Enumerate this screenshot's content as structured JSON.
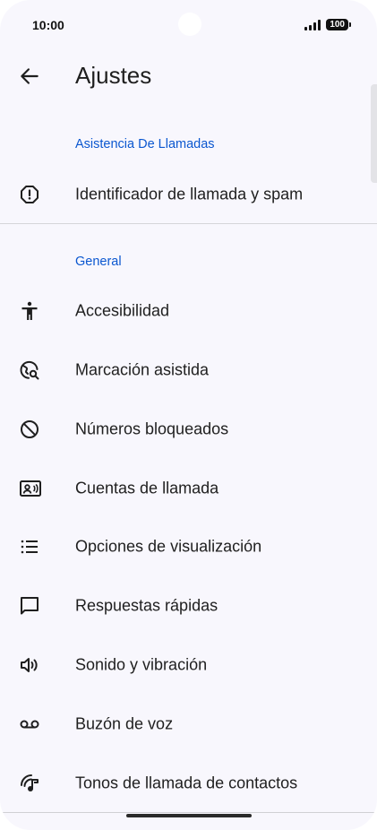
{
  "status": {
    "time": "10:00",
    "battery": "100"
  },
  "app_bar": {
    "title": "Ajustes"
  },
  "sections": {
    "call_assist": {
      "header": "Asistencia De Llamadas",
      "items": [
        {
          "label": "Identificador de llamada y spam",
          "icon": "alert-octagon-icon"
        }
      ]
    },
    "general": {
      "header": "General",
      "items": [
        {
          "label": "Accesibilidad",
          "icon": "accessibility-icon"
        },
        {
          "label": "Marcación asistida",
          "icon": "globe-search-icon"
        },
        {
          "label": "Números bloqueados",
          "icon": "block-icon"
        },
        {
          "label": "Cuentas de llamada",
          "icon": "contact-card-icon"
        },
        {
          "label": "Opciones de visualización",
          "icon": "list-icon"
        },
        {
          "label": "Respuestas rápidas",
          "icon": "chat-bubble-icon"
        },
        {
          "label": "Sonido y vibración",
          "icon": "volume-icon"
        },
        {
          "label": "Buzón de voz",
          "icon": "voicemail-icon"
        },
        {
          "label": "Tonos de llamada de contactos",
          "icon": "ringtone-icon"
        }
      ]
    }
  }
}
